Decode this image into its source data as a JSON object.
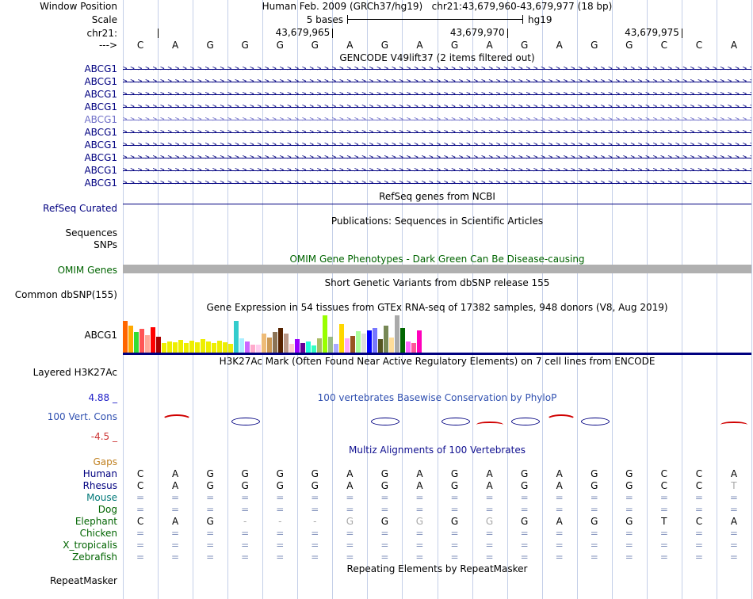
{
  "header": {
    "window_position_label": "Window Position",
    "assembly": "Human Feb. 2009 (GRCh37/hg19)",
    "position": "chr21:43,679,960-43,679,977 (18 bp)",
    "scale_label": "Scale",
    "scale_bases": "5 bases",
    "scale_assembly": "hg19",
    "chrom_label": "chr21:",
    "strand_label": "--->",
    "ruler_tick_boundaries": [
      1,
      6,
      11,
      16
    ],
    "ruler_labels": [
      {
        "text": "43,679,965",
        "boundary": 6
      },
      {
        "text": "43,679,970",
        "boundary": 11
      },
      {
        "text": "43,679,975",
        "boundary": 16
      }
    ]
  },
  "sequence": [
    "C",
    "A",
    "G",
    "G",
    "G",
    "G",
    "A",
    "G",
    "A",
    "G",
    "A",
    "G",
    "A",
    "G",
    "G",
    "C",
    "C",
    "A"
  ],
  "gencode": {
    "title": "GENCODE V49lift37 (2 items filtered out)",
    "transcripts": [
      {
        "label": "ABCG1",
        "color": "#000080"
      },
      {
        "label": "ABCG1",
        "color": "#000080"
      },
      {
        "label": "ABCG1",
        "color": "#000080"
      },
      {
        "label": "ABCG1",
        "color": "#000080"
      },
      {
        "label": "ABCG1",
        "color": "#6f6fc8"
      },
      {
        "label": "ABCG1",
        "color": "#000080"
      },
      {
        "label": "ABCG1",
        "color": "#000080"
      },
      {
        "label": "ABCG1",
        "color": "#000080"
      },
      {
        "label": "ABCG1",
        "color": "#000080"
      },
      {
        "label": "ABCG1",
        "color": "#000080"
      }
    ]
  },
  "refseq": {
    "title": "RefSeq genes from NCBI",
    "label": "RefSeq Curated"
  },
  "publications": {
    "title": "Publications: Sequences in Scientific Articles",
    "label_sequences": "Sequences",
    "label_snps": "SNPs"
  },
  "omim": {
    "title": "OMIM Gene Phenotypes - Dark Green Can Be Disease-causing",
    "label": "OMIM Genes",
    "bar_color": "#b0b0b0"
  },
  "dbsnp": {
    "title": "Short Genetic Variants from dbSNP release 155",
    "label": "Common dbSNP(155)"
  },
  "gtex": {
    "title": "Gene Expression in 54 tissues from GTEx RNA-seq of 17382 samples, 948 donors (V8, Aug 2019)",
    "label": "ABCG1",
    "bars": [
      {
        "h": 40,
        "c": "#FF6600"
      },
      {
        "h": 34,
        "c": "#FFAA00"
      },
      {
        "h": 26,
        "c": "#33DD33"
      },
      {
        "h": 30,
        "c": "#FF5555"
      },
      {
        "h": 22,
        "c": "#FFAA99"
      },
      {
        "h": 32,
        "c": "#FF0000"
      },
      {
        "h": 20,
        "c": "#AA0000"
      },
      {
        "h": 12,
        "c": "#EEEE00"
      },
      {
        "h": 14,
        "c": "#EEEE00"
      },
      {
        "h": 13,
        "c": "#EEEE00"
      },
      {
        "h": 16,
        "c": "#EEEE00"
      },
      {
        "h": 12,
        "c": "#EEEE00"
      },
      {
        "h": 15,
        "c": "#EEEE00"
      },
      {
        "h": 13,
        "c": "#EEEE00"
      },
      {
        "h": 17,
        "c": "#EEEE00"
      },
      {
        "h": 14,
        "c": "#EEEE00"
      },
      {
        "h": 12,
        "c": "#EEEE00"
      },
      {
        "h": 15,
        "c": "#EEEE00"
      },
      {
        "h": 13,
        "c": "#EEEE00"
      },
      {
        "h": 11,
        "c": "#EEEE00"
      },
      {
        "h": 40,
        "c": "#33CCCC"
      },
      {
        "h": 18,
        "c": "#AAEEFF"
      },
      {
        "h": 14,
        "c": "#CC66FF"
      },
      {
        "h": 10,
        "c": "#FFAACC"
      },
      {
        "h": 10,
        "c": "#FFCCEE"
      },
      {
        "h": 24,
        "c": "#EEBB77"
      },
      {
        "h": 19,
        "c": "#CC9955"
      },
      {
        "h": 26,
        "c": "#8B7355"
      },
      {
        "h": 31,
        "c": "#552200"
      },
      {
        "h": 24,
        "c": "#BB9988"
      },
      {
        "h": 11,
        "c": "#FFCCCC"
      },
      {
        "h": 17,
        "c": "#9900FF"
      },
      {
        "h": 12,
        "c": "#660099"
      },
      {
        "h": 14,
        "c": "#22FFDD"
      },
      {
        "h": 9,
        "c": "#33FFC2"
      },
      {
        "h": 18,
        "c": "#AABB66"
      },
      {
        "h": 47,
        "c": "#99FF00"
      },
      {
        "h": 20,
        "c": "#99BB88"
      },
      {
        "h": 11,
        "c": "#AAAAFF"
      },
      {
        "h": 36,
        "c": "#FFD700"
      },
      {
        "h": 18,
        "c": "#FFAAFF"
      },
      {
        "h": 21,
        "c": "#995522"
      },
      {
        "h": 27,
        "c": "#AAFF99"
      },
      {
        "h": 24,
        "c": "#DDDDDD"
      },
      {
        "h": 28,
        "c": "#0000FF"
      },
      {
        "h": 31,
        "c": "#7777FF"
      },
      {
        "h": 17,
        "c": "#555522"
      },
      {
        "h": 34,
        "c": "#778855"
      },
      {
        "h": 19,
        "c": "#FFDD99"
      },
      {
        "h": 47,
        "c": "#AAAAAA"
      },
      {
        "h": 31,
        "c": "#006600"
      },
      {
        "h": 14,
        "c": "#FF66FF"
      },
      {
        "h": 12,
        "c": "#FF5599"
      },
      {
        "h": 28,
        "c": "#FF00BB"
      }
    ]
  },
  "h3k27ac": {
    "title": "H3K27Ac Mark (Often Found Near Active Regulatory Elements) on 7 cell lines from ENCODE",
    "label": "Layered H3K27Ac"
  },
  "conservation": {
    "title": "100 vertebrates Basewise Conservation by PhyloP",
    "label": "100 Vert. Cons",
    "max_label": "4.88 _",
    "min_label": "-4.5 _",
    "marks": [
      {
        "col": 1,
        "type": "red"
      },
      {
        "col": 3,
        "type": "blue"
      },
      {
        "col": 7,
        "type": "blue"
      },
      {
        "col": 9,
        "type": "blue"
      },
      {
        "col": 10,
        "type": "redlow"
      },
      {
        "col": 11,
        "type": "blue"
      },
      {
        "col": 12,
        "type": "red"
      },
      {
        "col": 13,
        "type": "blue"
      },
      {
        "col": 17,
        "type": "redlow"
      }
    ]
  },
  "multiz": {
    "title": "Multiz Alignments of 100 Vertebrates",
    "gaps_label": "Gaps",
    "rows": [
      {
        "name": "Human",
        "name_color": "#000080",
        "dim": [],
        "cells": [
          "C",
          "A",
          "G",
          "G",
          "G",
          "G",
          "A",
          "G",
          "A",
          "G",
          "A",
          "G",
          "A",
          "G",
          "G",
          "C",
          "C",
          "A"
        ]
      },
      {
        "name": "Rhesus",
        "name_color": "#000080",
        "dim": [
          17
        ],
        "cells": [
          "C",
          "A",
          "G",
          "G",
          "G",
          "G",
          "A",
          "G",
          "A",
          "G",
          "A",
          "G",
          "A",
          "G",
          "G",
          "C",
          "C",
          "T"
        ]
      },
      {
        "name": "Mouse",
        "name_color": "#007878",
        "dim": [],
        "cells": [
          "=",
          "=",
          "=",
          "=",
          "=",
          "=",
          "=",
          "=",
          "=",
          "=",
          "=",
          "=",
          "=",
          "=",
          "=",
          "=",
          "=",
          "="
        ]
      },
      {
        "name": "Dog",
        "name_color": "#006400",
        "dim": [],
        "cells": [
          "=",
          "=",
          "=",
          "=",
          "=",
          "=",
          "=",
          "=",
          "=",
          "=",
          "=",
          "=",
          "=",
          "=",
          "=",
          "=",
          "=",
          "="
        ]
      },
      {
        "name": "Elephant",
        "name_color": "#006400",
        "dim": [
          3,
          4,
          5,
          6,
          8,
          10
        ],
        "cells": [
          "C",
          "A",
          "G",
          "-",
          "-",
          "-",
          "G",
          "G",
          "G",
          "G",
          "G",
          "G",
          "A",
          "G",
          "G",
          "T",
          "C",
          "A"
        ]
      },
      {
        "name": "Chicken",
        "name_color": "#006400",
        "dim": [],
        "cells": [
          "=",
          "=",
          "=",
          "=",
          "=",
          "=",
          "=",
          "=",
          "=",
          "=",
          "=",
          "=",
          "=",
          "=",
          "=",
          "=",
          "=",
          "="
        ]
      },
      {
        "name": "X_tropicalis",
        "name_color": "#006400",
        "dim": [],
        "cells": [
          "=",
          "=",
          "=",
          "=",
          "=",
          "=",
          "=",
          "=",
          "=",
          "=",
          "=",
          "=",
          "=",
          "=",
          "=",
          "=",
          "=",
          "="
        ]
      },
      {
        "name": "Zebrafish",
        "name_color": "#006400",
        "dim": [],
        "cells": [
          "=",
          "=",
          "=",
          "=",
          "=",
          "=",
          "=",
          "=",
          "=",
          "=",
          "=",
          "=",
          "=",
          "=",
          "=",
          "=",
          "=",
          "="
        ]
      }
    ]
  },
  "repeatmasker": {
    "title": "Repeating Elements by RepeatMasker",
    "label": "RepeatMasker"
  },
  "colors": {
    "grid": "#c4cfe8",
    "navy": "#000080",
    "omim_green": "#006400",
    "gaps_orange": "#c08020",
    "cons_pos_red": "#d00000",
    "cons_neg_blue": "#000080",
    "align_eq": "#8090bb",
    "dim_text": "#a8a8a8"
  }
}
